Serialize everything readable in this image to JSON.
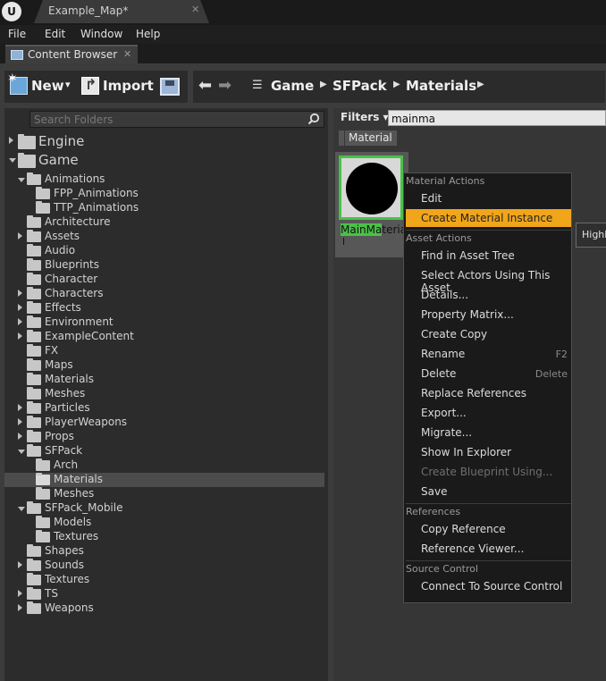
{
  "title_bar": {
    "app_logo": "U",
    "map_tab": "Example_Map*",
    "close_glyph": "✕"
  },
  "menu": [
    "File",
    "Edit",
    "Window",
    "Help"
  ],
  "panel_tab": {
    "label": "Content Browser",
    "close_glyph": "✕"
  },
  "toolbar": {
    "new_label": "New",
    "import_label": "Import",
    "dropdown_glyph": "▾"
  },
  "breadcrumb": [
    "Game",
    "SFPack",
    "Materials"
  ],
  "folder_search": {
    "placeholder": "Search Folders"
  },
  "tree": [
    {
      "label": "Engine",
      "indent": 0,
      "expander": "right",
      "big": true
    },
    {
      "label": "Game",
      "indent": 0,
      "expander": "down",
      "big": true
    },
    {
      "label": "Animations",
      "indent": 1,
      "expander": "down"
    },
    {
      "label": "FPP_Animations",
      "indent": 2,
      "expander": "none"
    },
    {
      "label": "TTP_Animations",
      "indent": 2,
      "expander": "none"
    },
    {
      "label": "Architecture",
      "indent": 1,
      "expander": "none"
    },
    {
      "label": "Assets",
      "indent": 1,
      "expander": "right"
    },
    {
      "label": "Audio",
      "indent": 1,
      "expander": "none"
    },
    {
      "label": "Blueprints",
      "indent": 1,
      "expander": "none"
    },
    {
      "label": "Character",
      "indent": 1,
      "expander": "none"
    },
    {
      "label": "Characters",
      "indent": 1,
      "expander": "right"
    },
    {
      "label": "Effects",
      "indent": 1,
      "expander": "right"
    },
    {
      "label": "Environment",
      "indent": 1,
      "expander": "right"
    },
    {
      "label": "ExampleContent",
      "indent": 1,
      "expander": "right"
    },
    {
      "label": "FX",
      "indent": 1,
      "expander": "none"
    },
    {
      "label": "Maps",
      "indent": 1,
      "expander": "none"
    },
    {
      "label": "Materials",
      "indent": 1,
      "expander": "none"
    },
    {
      "label": "Meshes",
      "indent": 1,
      "expander": "none"
    },
    {
      "label": "Particles",
      "indent": 1,
      "expander": "right"
    },
    {
      "label": "PlayerWeapons",
      "indent": 1,
      "expander": "right"
    },
    {
      "label": "Props",
      "indent": 1,
      "expander": "right"
    },
    {
      "label": "SFPack",
      "indent": 1,
      "expander": "down"
    },
    {
      "label": "Arch",
      "indent": 2,
      "expander": "none"
    },
    {
      "label": "Materials",
      "indent": 2,
      "expander": "none",
      "selected": true,
      "open": true
    },
    {
      "label": "Meshes",
      "indent": 2,
      "expander": "none"
    },
    {
      "label": "SFPack_Mobile",
      "indent": 1,
      "expander": "down"
    },
    {
      "label": "Models",
      "indent": 2,
      "expander": "none"
    },
    {
      "label": "Textures",
      "indent": 2,
      "expander": "none"
    },
    {
      "label": "Shapes",
      "indent": 1,
      "expander": "none"
    },
    {
      "label": "Sounds",
      "indent": 1,
      "expander": "right"
    },
    {
      "label": "Textures",
      "indent": 1,
      "expander": "none"
    },
    {
      "label": "TS",
      "indent": 1,
      "expander": "right"
    },
    {
      "label": "Weapons",
      "indent": 1,
      "expander": "right"
    }
  ],
  "filters": {
    "label": "Filters",
    "search_value": "mainma",
    "chip": "Material"
  },
  "asset": {
    "name_highlight": "MainMa",
    "name_rest": "teria",
    "second_line": "l"
  },
  "context_menu": [
    {
      "type": "header",
      "label": "Material Actions"
    },
    {
      "type": "item",
      "label": "Edit"
    },
    {
      "type": "item",
      "label": "Create Material Instance",
      "highlighted": true
    },
    {
      "type": "header",
      "label": "Asset Actions"
    },
    {
      "type": "item",
      "label": "Find in Asset Tree"
    },
    {
      "type": "item",
      "label": "Select Actors Using This Asset"
    },
    {
      "type": "item",
      "label": "Details..."
    },
    {
      "type": "item",
      "label": "Property Matrix..."
    },
    {
      "type": "item",
      "label": "Create Copy"
    },
    {
      "type": "item",
      "label": "Rename",
      "shortcut": "F2"
    },
    {
      "type": "item",
      "label": "Delete",
      "shortcut": "Delete"
    },
    {
      "type": "item",
      "label": "Replace References"
    },
    {
      "type": "item",
      "label": "Export..."
    },
    {
      "type": "item",
      "label": "Migrate..."
    },
    {
      "type": "item",
      "label": "Show In Explorer"
    },
    {
      "type": "item",
      "label": "Create Blueprint Using...",
      "disabled": true
    },
    {
      "type": "item",
      "label": "Save"
    },
    {
      "type": "header",
      "label": "References"
    },
    {
      "type": "item",
      "label": "Copy Reference"
    },
    {
      "type": "item",
      "label": "Reference Viewer..."
    },
    {
      "type": "header",
      "label": "Source Control"
    },
    {
      "type": "item",
      "label": "Connect To Source Control"
    }
  ],
  "tooltip": "Highl",
  "colors": {
    "highlight": "#f0a51a",
    "selection_green": "#4ac148"
  }
}
